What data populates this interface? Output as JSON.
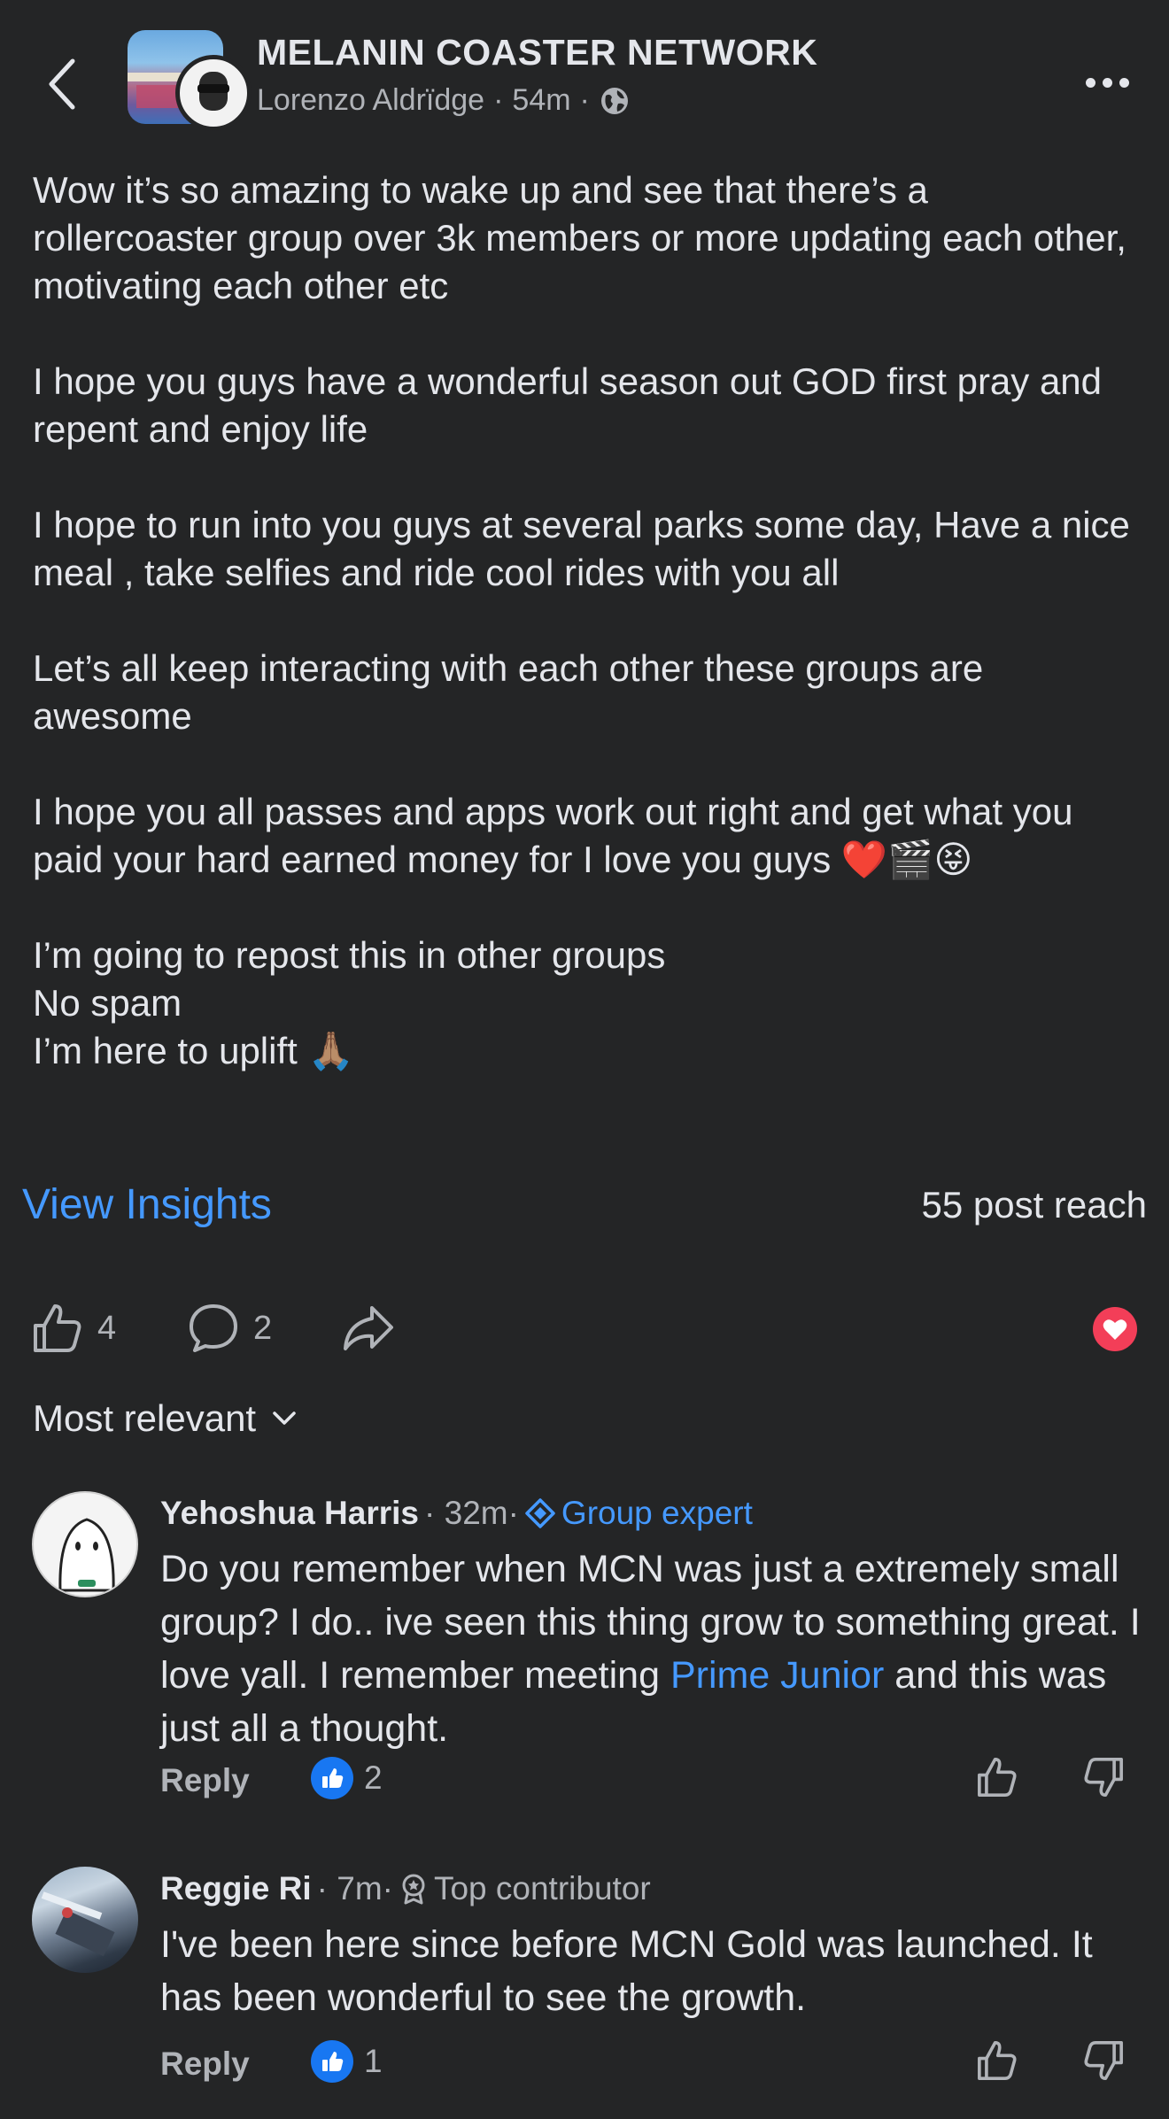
{
  "header": {
    "back_icon": "chevron-left-icon",
    "group_name": "MELANIN COASTER NETWORK",
    "author": "Lorenzo Aldrïdge",
    "separator": "·",
    "time": "54m",
    "privacy_icon": "globe-icon",
    "more_icon": "more-horizontal-icon"
  },
  "post": {
    "paragraphs": [
      "Wow it’s so amazing to wake up and see that there’s a rollercoaster group over 3k members or more updating each other, motivating each other etc",
      "I hope you guys have a wonderful season out GOD first pray and repent and enjoy life",
      "I hope to run into you guys at several parks some day, Have a nice meal , take selfies and ride cool rides with you all",
      "Let’s all keep interacting with each other these groups are awesome",
      "I hope you all passes and apps work out right and get what you paid your hard earned money for I love you guys ❤️🎬😝",
      "I’m going to repost this in other groups\nNo spam\nI’m here to uplift 🙏🏽"
    ]
  },
  "insights": {
    "view_insights": "View Insights",
    "post_reach": "55 post reach"
  },
  "actions": {
    "like_count": "4",
    "comment_count": "2",
    "reaction_icon": "heart-icon",
    "reaction_color": "#f33e58"
  },
  "sort": {
    "label": "Most relevant"
  },
  "comments": [
    {
      "name": "Yehoshua Harris",
      "meta": "· 32m·",
      "badge": "Group expert",
      "badge_icon": "diamond-icon",
      "text_before": "Do you remember when MCN was just a extremely small group? I do.. ive seen this thing grow to something great. I love yall. I remember meeting ",
      "mention": "Prime Junior",
      "text_after": " and this was just all a thought.",
      "reply": "Reply",
      "likes": "2"
    },
    {
      "name": "Reggie Ri",
      "meta": "· 7m·",
      "badge": "Top contributor",
      "badge_icon": "award-icon",
      "text": "I've been here since before MCN Gold was launched. It has been wonderful to see the growth.",
      "reply": "Reply",
      "likes": "1"
    }
  ],
  "colors": {
    "background": "#242526",
    "link": "#4599ff",
    "text": "#e4e6eb",
    "secondary_text": "#b0b3b8",
    "like_blue": "#1877f2"
  }
}
